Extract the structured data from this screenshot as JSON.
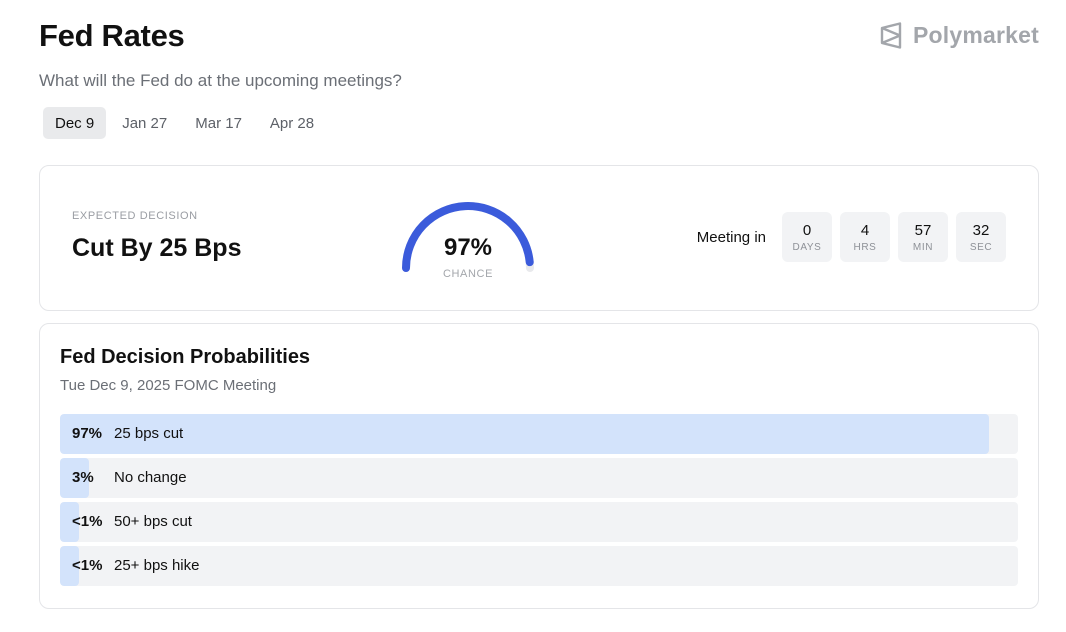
{
  "header": {
    "title": "Fed Rates",
    "subtitle": "What will the Fed do at the upcoming meetings?",
    "brand": "Polymarket"
  },
  "tabs": [
    {
      "label": "Dec 9",
      "active": true
    },
    {
      "label": "Jan 27",
      "active": false
    },
    {
      "label": "Mar 17",
      "active": false
    },
    {
      "label": "Apr 28",
      "active": false
    }
  ],
  "summary": {
    "expected_label": "EXPECTED DECISION",
    "expected_value": "Cut By 25 Bps",
    "chance_value": "97%",
    "chance_fraction": 0.97,
    "chance_label": "CHANCE",
    "meeting_label": "Meeting in",
    "countdown": [
      {
        "value": "0",
        "unit": "DAYS"
      },
      {
        "value": "4",
        "unit": "HRS"
      },
      {
        "value": "57",
        "unit": "MIN"
      },
      {
        "value": "32",
        "unit": "SEC"
      }
    ]
  },
  "probabilities": {
    "title": "Fed Decision Probabilities",
    "subtitle": "Tue Dec 9, 2025 FOMC Meeting",
    "rows": [
      {
        "pct": "97%",
        "label": "25 bps cut",
        "fraction": 0.97
      },
      {
        "pct": "3%",
        "label": "No change",
        "fraction": 0.03
      },
      {
        "pct": "<1%",
        "label": "50+ bps cut",
        "fraction": 0.01
      },
      {
        "pct": "<1%",
        "label": "25+ bps hike",
        "fraction": 0.01
      }
    ]
  },
  "colors": {
    "gauge_fill": "#3b5bdb",
    "gauge_track": "#e8e9ec",
    "bar_fill": "#d3e3fb",
    "bar_track": "#f2f3f5"
  }
}
